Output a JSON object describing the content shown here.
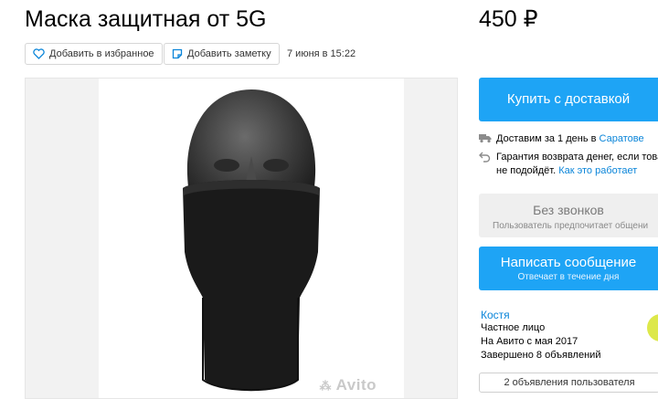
{
  "header": {
    "title": "Маска защитная от 5G",
    "price": "450 ₽"
  },
  "actions": {
    "favorite_label": "Добавить в избранное",
    "note_label": "Добавить заметку",
    "date": "7 июня в 15:22"
  },
  "gallery": {
    "watermark": "Avito"
  },
  "purchase": {
    "buy_label": "Купить с доставкой",
    "delivery_text": "Доставим за 1 день в ",
    "delivery_city": "Саратове",
    "guarantee_line1": "Гарантия возврата денег, если това",
    "guarantee_line2": "не подойдёт. ",
    "guarantee_link": "Как это работает"
  },
  "contact": {
    "no_calls_title": "Без звонков",
    "no_calls_subtitle": "Пользователь предпочитает общени",
    "write_title": "Написать сообщение",
    "write_subtitle": "Отвечает в течение дня"
  },
  "seller": {
    "name": "Костя",
    "type": "Частное лицо",
    "since": "На Авито с мая 2017",
    "completed": "Завершено 8 объявлений",
    "ads_button": "2 объявления пользователя"
  },
  "colors": {
    "accent": "#1ea4f5",
    "link": "#0a85d9"
  },
  "icons": [
    "heart-icon",
    "note-icon",
    "truck-icon",
    "return-arrow-icon",
    "avito-logo-icon"
  ]
}
